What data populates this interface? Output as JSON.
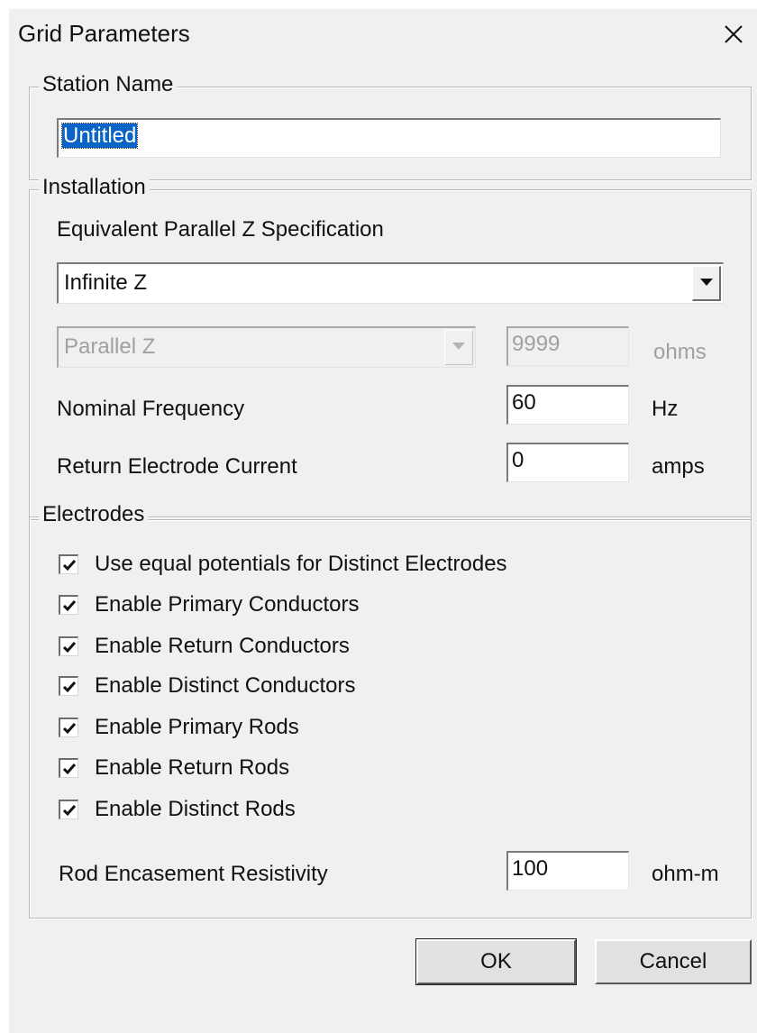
{
  "dialog": {
    "title": "Grid Parameters",
    "close_icon": "close-icon"
  },
  "station": {
    "legend": "Station Name",
    "name_value": "Untitled"
  },
  "installation": {
    "legend": "Installation",
    "spec_label": "Equivalent Parallel Z Specification",
    "spec_selected": "Infinite Z",
    "parallel_type_selected": "Parallel Z",
    "parallel_z_value": "9999",
    "parallel_z_unit": "ohms",
    "frequency_label": "Nominal Frequency",
    "frequency_value": "60",
    "frequency_unit": "Hz",
    "return_current_label": "Return Electrode Current",
    "return_current_value": "0",
    "return_current_unit": "amps"
  },
  "electrodes": {
    "legend": "Electrodes",
    "options": [
      {
        "label": "Use equal potentials for Distinct Electrodes",
        "checked": true
      },
      {
        "label": "Enable Primary Conductors",
        "checked": true
      },
      {
        "label": "Enable Return Conductors",
        "checked": true
      },
      {
        "label": "Enable Distinct Conductors",
        "checked": true
      },
      {
        "label": "Enable Primary Rods",
        "checked": true
      },
      {
        "label": "Enable Return Rods",
        "checked": true
      },
      {
        "label": "Enable Distinct Rods",
        "checked": true
      }
    ],
    "resistivity_label": "Rod Encasement Resistivity",
    "resistivity_value": "100",
    "resistivity_unit": "ohm-m"
  },
  "buttons": {
    "ok_label": "OK",
    "cancel_label": "Cancel"
  },
  "icons": {
    "dropdown": "chevron-down-icon",
    "checkmark": "checkmark-icon"
  },
  "colors": {
    "dialog_bg": "#f0f0f0",
    "selection_bg": "#0a64c8",
    "disabled_text": "#a0a0a0"
  }
}
